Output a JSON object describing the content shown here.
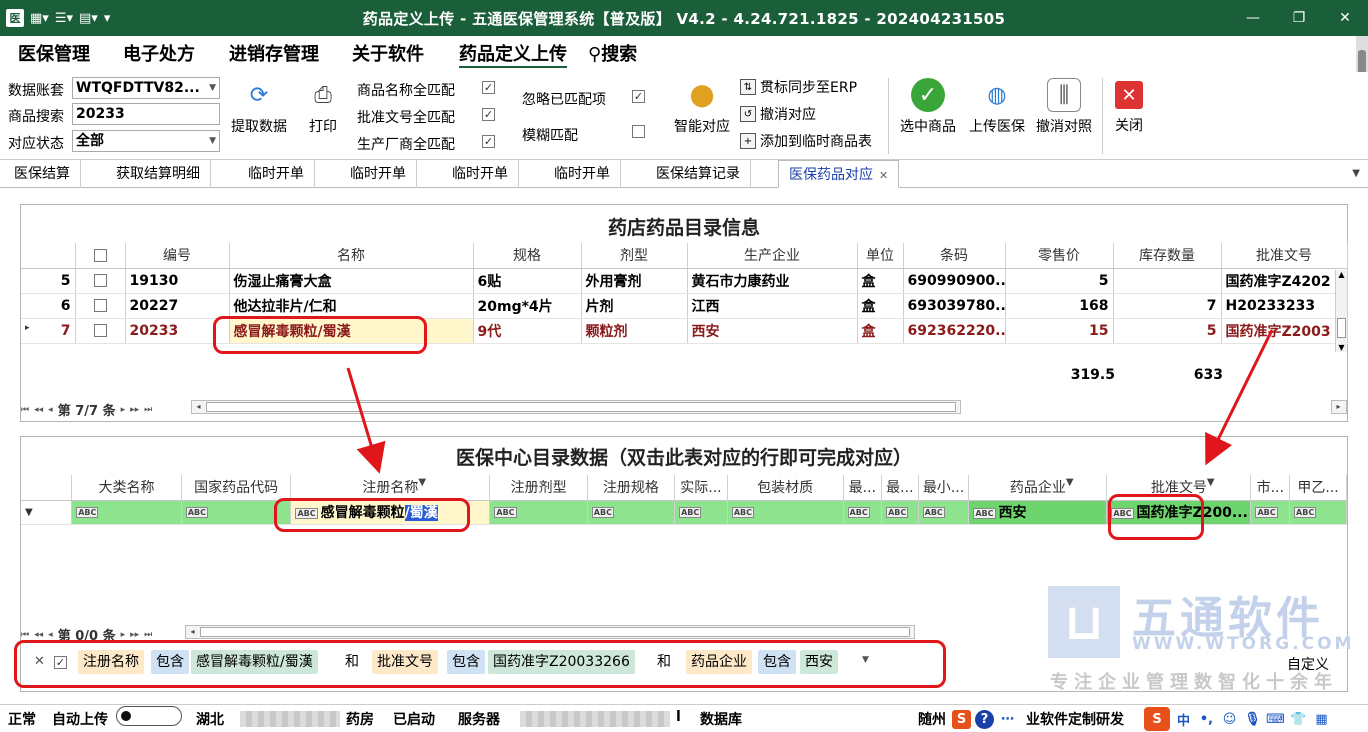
{
  "window": {
    "title": "药品定义上传 - 五通医保管理系统【普及版】 V4.2 - 4.24.721.1825 - 202404231505",
    "app_icon": "医"
  },
  "menu": [
    {
      "label": "医保管理"
    },
    {
      "label": "电子处方"
    },
    {
      "label": "进销存管理"
    },
    {
      "label": "关于软件"
    },
    {
      "label": "药品定义上传"
    },
    {
      "label": "搜索"
    }
  ],
  "form": {
    "account_label": "数据账套",
    "account_value": "WTQFDTTV82...",
    "search_label": "商品搜索",
    "search_value": "20233",
    "status_label": "对应状态",
    "status_value": "全部"
  },
  "toolbar": {
    "fetch": "提取数据",
    "print": "打印",
    "opt_name": "商品名称全匹配",
    "opt_approval": "批准文号全匹配",
    "opt_maker": "生产厂商全匹配",
    "opt_ignore": "忽略已匹配项",
    "opt_fuzzy": "模糊匹配",
    "smart": "智能对应",
    "sync_erp": "贯标同步至ERP",
    "undo_map": "撤消对应",
    "add_temp": "添加到临时商品表",
    "select": "选中商品",
    "upload": "上传医保",
    "cancel_ref": "撤消对照",
    "close": "关闭"
  },
  "tabs": [
    {
      "label": "医保结算"
    },
    {
      "label": "获取结算明细"
    },
    {
      "label": "临时开单"
    },
    {
      "label": "临时开单"
    },
    {
      "label": "临时开单"
    },
    {
      "label": "临时开单"
    },
    {
      "label": "医保结算记录"
    },
    {
      "label": "医保药品对应"
    }
  ],
  "top_grid": {
    "title": "药店药品目录信息",
    "columns": [
      "编号",
      "名称",
      "规格",
      "剂型",
      "生产企业",
      "单位",
      "条码",
      "零售价",
      "库存数量",
      "批准文号"
    ],
    "rows": [
      {
        "idx": "5",
        "code": "19130",
        "name": "伤湿止痛膏大盒",
        "spec": "6贴",
        "form": "外用膏剂",
        "maker": "黄石市力康药业",
        "unit": "盒",
        "barcode": "690990900...",
        "price": "5",
        "stock": "",
        "approval": "国药准字Z4202"
      },
      {
        "idx": "6",
        "code": "20227",
        "name": "他达拉非片/仁和",
        "spec": "20mg*4片",
        "form": "片剂",
        "maker": "江西",
        "unit": "盒",
        "barcode": "693039780...",
        "price": "168",
        "stock": "7",
        "approval": "H20233233"
      },
      {
        "idx": "7",
        "code": "20233",
        "name": "感冒解毒颗粒/蜀漢",
        "spec": "9代",
        "form": "颗粒剂",
        "maker": "西安",
        "unit": "盒",
        "barcode": "692362220...",
        "price": "15",
        "stock": "5",
        "approval": "国药准字Z2003"
      }
    ],
    "sum_price": "319.5",
    "sum_stock": "633",
    "nav": "第 7/7 条"
  },
  "bottom_grid": {
    "title": "医保中心目录数据（双击此表对应的行即可完成对应）",
    "columns": [
      "大类名称",
      "国家药品代码",
      "注册名称",
      "注册剂型",
      "注册规格",
      "实际...",
      "包装材质",
      "最...",
      "最...",
      "最小...",
      "药品企业",
      "批准文号",
      "市...",
      "甲乙..."
    ],
    "filter": {
      "token": "ABC",
      "name_a": "感冒解毒颗粒",
      "name_sep": "/",
      "name_b": "蜀漢",
      "maker": "西安",
      "approval": "国药准字Z200..."
    },
    "nav": "第 0/0 条"
  },
  "filterbar": {
    "f1_field": "注册名称",
    "f1_op": "包含",
    "f1_value": "感冒解毒颗粒/蜀漢",
    "and1": "和",
    "f2_field": "批准文号",
    "f2_op": "包含",
    "f2_value": "国药准字Z20033266",
    "and2": "和",
    "f3_field": "药品企业",
    "f3_op": "包含",
    "f3_value": "西安",
    "customize": "自定义"
  },
  "watermark": {
    "brand": "五通软件",
    "url": "WWW.WTORG.COM",
    "slogan": "专注企业管理数智化十余年"
  },
  "status": {
    "mode": "正常",
    "auto_upload": "自动上传",
    "region": "湖北",
    "store": "药房",
    "started": "已启动",
    "server": "服务器",
    "l": "l",
    "db": "数据库",
    "city": "随州",
    "tail": "业软件定制研发"
  },
  "colors": {
    "title_bg": "#1b5e3a",
    "highlight_red": "#e0161a",
    "filter_row": "#8ee38e"
  }
}
